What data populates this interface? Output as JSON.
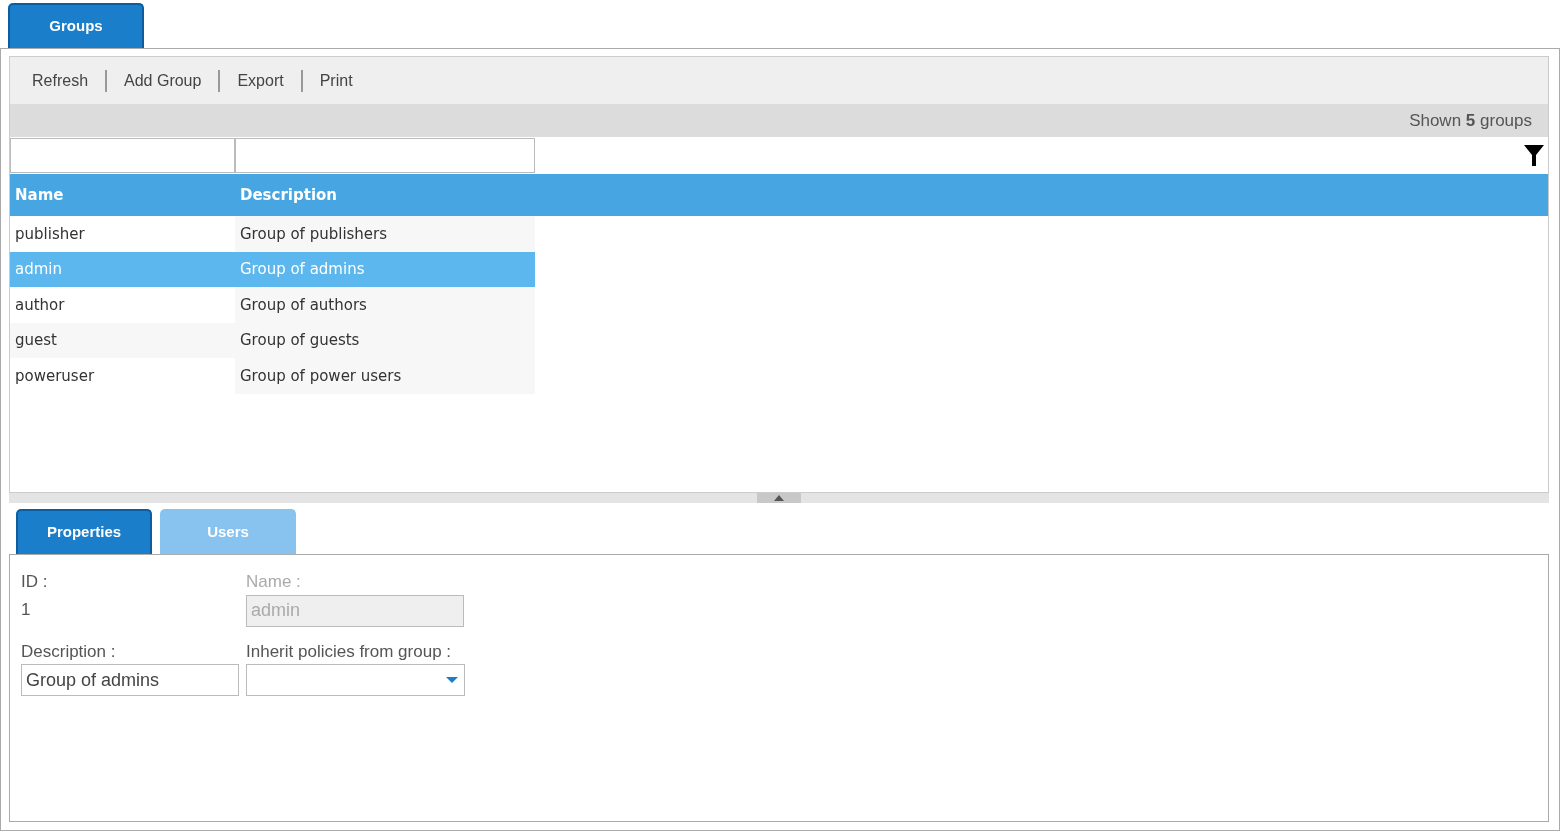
{
  "main_tabs": [
    {
      "label": "Groups",
      "selected": true
    }
  ],
  "toolbar": {
    "buttons": [
      "Refresh",
      "Add Group",
      "Export",
      "Print"
    ]
  },
  "status": "Shown **5** groups",
  "filters": [
    {
      "kind": "text"
    },
    {
      "kind": "text"
    }
  ],
  "table": {
    "columns": [
      "Name",
      "Description"
    ],
    "rows": [
      {
        "name": "publisher",
        "description": "Group of publishers",
        "selected": false
      },
      {
        "name": "admin",
        "description": "Group of admins",
        "selected": true
      },
      {
        "name": "author",
        "description": "Group of authors",
        "selected": false
      },
      {
        "name": "guest",
        "description": "Group of guests",
        "selected": false
      },
      {
        "name": "poweruser",
        "description": "Group of power users",
        "selected": false
      }
    ]
  },
  "detail_tabs": [
    {
      "label": "Properties",
      "selected": true
    },
    {
      "label": "Users",
      "selected": false
    }
  ],
  "properties": {
    "id": {
      "label": "ID :",
      "value": "1"
    },
    "name": {
      "label": "Name :",
      "value": "admin",
      "disabled": true
    },
    "description": {
      "label": "Description :",
      "value": "Group of admins"
    },
    "inherit": {
      "label": "Inherit policies from group :"
    }
  }
}
